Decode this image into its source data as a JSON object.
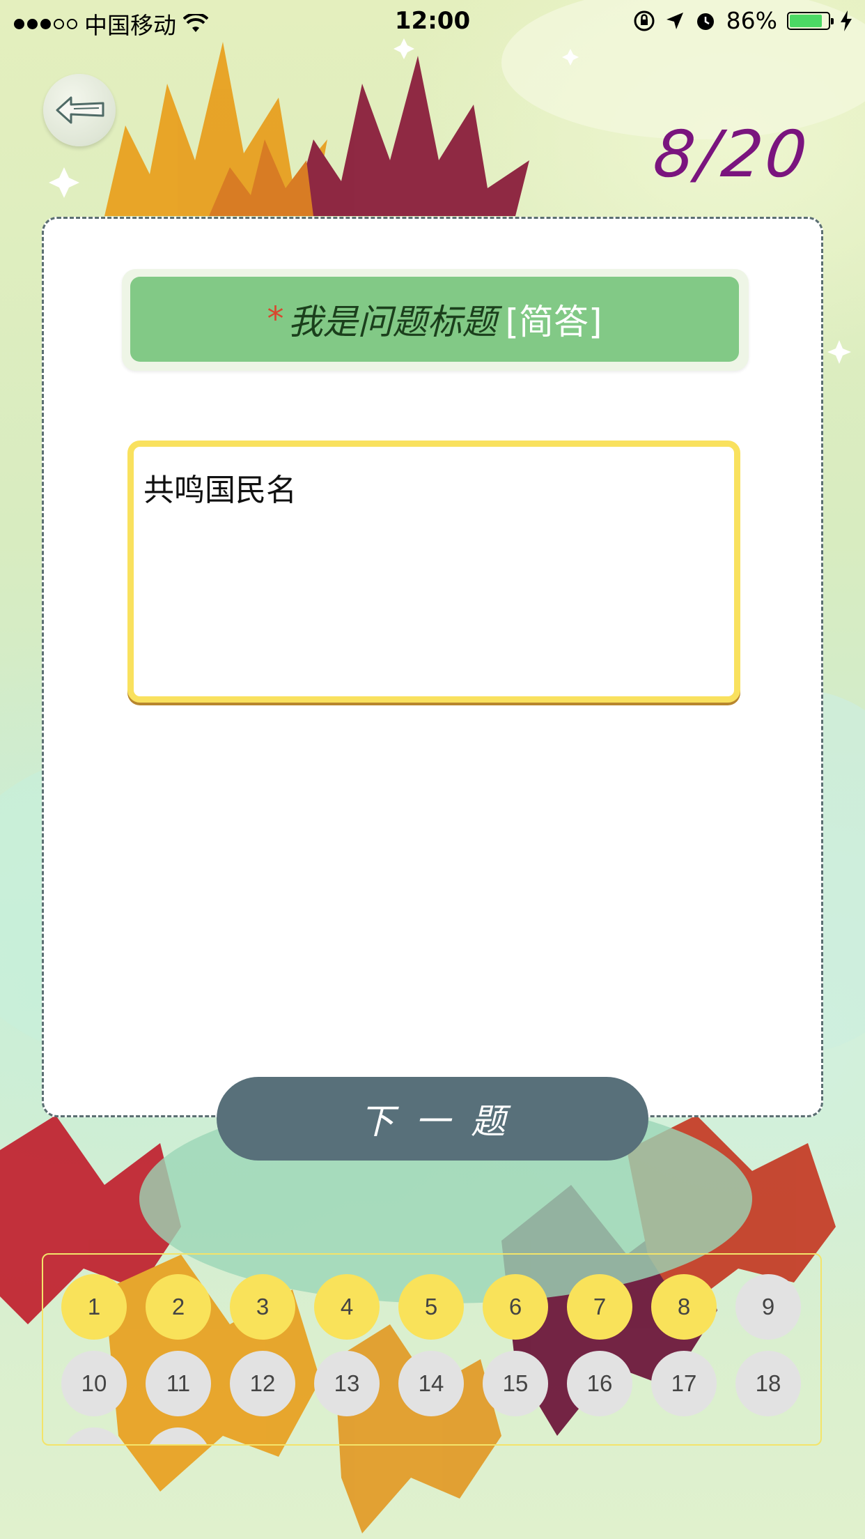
{
  "status_bar": {
    "carrier": "中国移动",
    "time": "12:00",
    "battery_percent": "86%",
    "battery_level": 0.86,
    "signal_bars_filled": 3,
    "signal_bars_total": 5
  },
  "progress": {
    "text": "8/20"
  },
  "question": {
    "required_mark": "*",
    "title": "我是问题标题",
    "type_tag": "[简答]"
  },
  "answer": {
    "value": "共鸣国民名"
  },
  "next_button": {
    "label": "下一题"
  },
  "question_nav": {
    "items": [
      {
        "number": "1",
        "answered": true
      },
      {
        "number": "2",
        "answered": true
      },
      {
        "number": "3",
        "answered": true
      },
      {
        "number": "4",
        "answered": true
      },
      {
        "number": "5",
        "answered": true
      },
      {
        "number": "6",
        "answered": true
      },
      {
        "number": "7",
        "answered": true
      },
      {
        "number": "8",
        "answered": true
      },
      {
        "number": "9",
        "answered": false
      },
      {
        "number": "10",
        "answered": false
      },
      {
        "number": "11",
        "answered": false
      },
      {
        "number": "12",
        "answered": false
      },
      {
        "number": "13",
        "answered": false
      },
      {
        "number": "14",
        "answered": false
      },
      {
        "number": "15",
        "answered": false
      },
      {
        "number": "16",
        "answered": false
      },
      {
        "number": "17",
        "answered": false
      },
      {
        "number": "18",
        "answered": false
      },
      {
        "number": "",
        "answered": false
      },
      {
        "number": "",
        "answered": false
      }
    ]
  },
  "colors": {
    "answered": "#f9e25a",
    "unanswered": "#e2e2e2",
    "progress": "#7a147e",
    "title_bar": "#82c986",
    "next_button": "#58707a",
    "required": "#d9472f"
  },
  "icons": {
    "back": "back-arrow-icon",
    "wifi": "wifi-icon",
    "rotation_lock": "rotation-lock-icon",
    "location": "location-arrow-icon",
    "alarm": "alarm-icon",
    "charging": "charging-bolt-icon"
  }
}
